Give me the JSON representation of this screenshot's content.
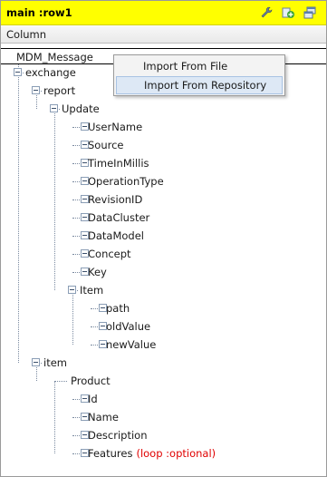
{
  "titlebar": {
    "title": "main :row1",
    "icons": [
      "wrench-icon",
      "add-node-icon",
      "windows-icon"
    ]
  },
  "column_header": "Column",
  "root": "MDM_Message",
  "context_menu": {
    "items": [
      "Import From File",
      "Import From Repository"
    ],
    "highlighted": "Import From Repository"
  },
  "tree": {
    "exchange": "exchange",
    "report": "report",
    "update": "Update",
    "update_children": [
      "UserName",
      "Source",
      "TimeInMillis",
      "OperationType",
      "RevisionID",
      "DataCluster",
      "DataModel",
      "Concept",
      "Key"
    ],
    "item_node": "Item",
    "item_children": [
      "path",
      "oldValue",
      "newValue"
    ],
    "item": "item",
    "product": "Product",
    "product_children": [
      "Id",
      "Name",
      "Description"
    ],
    "features": "Features",
    "features_note": "(loop :optional)"
  }
}
